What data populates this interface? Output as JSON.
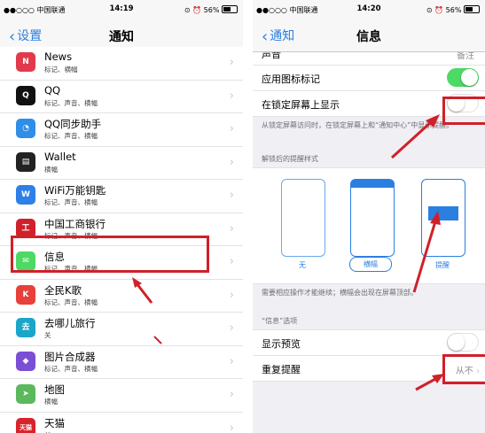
{
  "left": {
    "status": {
      "carrier": "●●○○○ 中国联通",
      "time": "14:19",
      "battery": "56%"
    },
    "nav": {
      "back": "设置",
      "title": "通知"
    },
    "apps": [
      {
        "name": "News",
        "sub": "标记、横幅",
        "icon": "news-icon",
        "color": "#e23a4c",
        "glyph": "N"
      },
      {
        "name": "QQ",
        "sub": "标记、声音、横幅",
        "icon": "qq-icon",
        "color": "#111111",
        "glyph": "Q"
      },
      {
        "name": "QQ同步助手",
        "sub": "标记、声音、横幅",
        "icon": "qq-sync-icon",
        "color": "#2f8ee8",
        "glyph": "◔"
      },
      {
        "name": "Wallet",
        "sub": "横幅",
        "icon": "wallet-icon",
        "color": "#222222",
        "glyph": "▤"
      },
      {
        "name": "WiFi万能钥匙",
        "sub": "标记、声音、横幅",
        "icon": "wifi-key-icon",
        "color": "#2f7fe8",
        "glyph": "W"
      },
      {
        "name": "中国工商银行",
        "sub": "标记、声音、横幅",
        "icon": "icbc-icon",
        "color": "#d0202a",
        "glyph": "工"
      },
      {
        "name": "信息",
        "sub": "标记、声音、横幅",
        "icon": "messages-icon",
        "color": "#4cd964",
        "glyph": "✉"
      },
      {
        "name": "全民K歌",
        "sub": "标记、声音、横幅",
        "icon": "kge-icon",
        "color": "#e8403a",
        "glyph": "K"
      },
      {
        "name": "去哪儿旅行",
        "sub": "关",
        "icon": "qunar-icon",
        "color": "#1aa6c9",
        "glyph": "去"
      },
      {
        "name": "图片合成器",
        "sub": "标记、声音、横幅",
        "icon": "photo-merge-icon",
        "color": "#7a4fd6",
        "glyph": "◆"
      },
      {
        "name": "地图",
        "sub": "横幅",
        "icon": "maps-icon",
        "color": "#5bb85d",
        "glyph": "➤"
      },
      {
        "name": "天猫",
        "sub": "关",
        "icon": "tmall-icon",
        "color": "#d8232a",
        "glyph": "天猫"
      }
    ]
  },
  "right": {
    "status": {
      "carrier": "●●○○○ 中国联通",
      "time": "14:20",
      "battery": "56%"
    },
    "nav": {
      "back": "通知",
      "title": "信息"
    },
    "top_partial": {
      "label": "声音",
      "value": "备注"
    },
    "badge_label": "应用图标标记",
    "lock_label": "在锁定屏幕上显示",
    "lock_note": "从锁定屏幕访问时，在锁定屏幕上和“通知中心”中显示提醒。",
    "style_header": "解锁后的提醒样式",
    "styles": [
      "无",
      "横幅",
      "提醒"
    ],
    "style_note": "需要相应操作才能继续；横幅会出现在屏幕顶部。",
    "options_header": "“信息”选项",
    "preview_label": "显示预览",
    "repeat_label": "重复提醒",
    "repeat_value": "从不"
  }
}
